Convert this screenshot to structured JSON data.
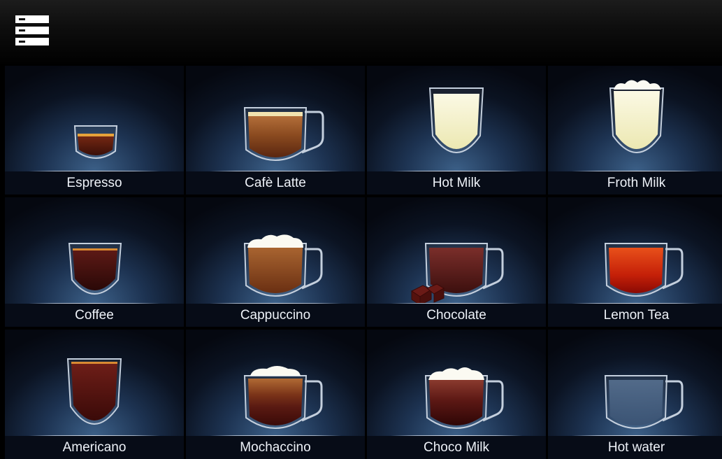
{
  "colors": {
    "background": "#000000",
    "tile_glow": "#3c6088",
    "label_bg": "#070c17",
    "label_text": "#eef2f8"
  },
  "header": {
    "menu_icon": "menu-list-icon"
  },
  "drinks": [
    {
      "label": "Espresso",
      "icon": "espresso-cup-icon"
    },
    {
      "label": "Cafè Latte",
      "icon": "cafe-latte-mug-icon"
    },
    {
      "label": "Hot Milk",
      "icon": "hot-milk-glass-icon"
    },
    {
      "label": "Froth Milk",
      "icon": "froth-milk-glass-icon"
    },
    {
      "label": "Coffee",
      "icon": "coffee-glass-icon"
    },
    {
      "label": "Cappuccino",
      "icon": "cappuccino-mug-icon"
    },
    {
      "label": "Chocolate",
      "icon": "chocolate-mug-icon"
    },
    {
      "label": "Lemon Tea",
      "icon": "lemon-tea-mug-icon"
    },
    {
      "label": "Americano",
      "icon": "americano-glass-icon"
    },
    {
      "label": "Mochaccino",
      "icon": "mochaccino-mug-icon"
    },
    {
      "label": "Choco Milk",
      "icon": "choco-milk-mug-icon"
    },
    {
      "label": "Hot water",
      "icon": "hot-water-mug-icon"
    }
  ]
}
